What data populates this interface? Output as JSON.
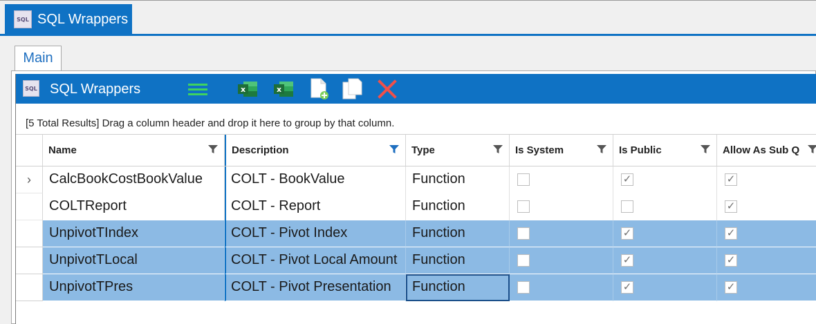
{
  "document_tab": {
    "icon": "sql-icon",
    "icon_text": "SQL",
    "title": "SQL Wrappers"
  },
  "main_tab": {
    "label": "Main"
  },
  "toolbar": {
    "icon_text": "SQL",
    "title": "SQL Wrappers",
    "buttons": [
      {
        "name": "menu-button",
        "icon": "hamburger-icon",
        "color": "#3fd35f"
      },
      {
        "name": "export-excel-button",
        "icon": "excel-icon",
        "color": "#1d8a45"
      },
      {
        "name": "export-excel-all-button",
        "icon": "excel-icon",
        "color": "#1d8a45"
      },
      {
        "name": "new-button",
        "icon": "new-document-icon"
      },
      {
        "name": "copy-button",
        "icon": "copy-icon"
      },
      {
        "name": "delete-button",
        "icon": "delete-x-icon",
        "color": "#f0504a"
      }
    ]
  },
  "group_panel": {
    "text": "[5 Total Results] Drag a column header and drop it here to group by that column."
  },
  "columns": [
    {
      "key": "name",
      "label": "Name",
      "filter_active": false
    },
    {
      "key": "description",
      "label": "Description",
      "filter_active": true
    },
    {
      "key": "type",
      "label": "Type",
      "filter_active": false
    },
    {
      "key": "is_system",
      "label": "Is System",
      "filter_active": false
    },
    {
      "key": "is_public",
      "label": "Is Public",
      "filter_active": false
    },
    {
      "key": "allow_sub",
      "label": "Allow As Sub Q",
      "filter_active": false
    }
  ],
  "rows": [
    {
      "indicator": "›",
      "name": "CalcBookCostBookValue",
      "description": "COLT - BookValue",
      "type": "Function",
      "is_system": false,
      "is_public": true,
      "allow_sub": true,
      "selected": false
    },
    {
      "indicator": "",
      "name": "COLTReport",
      "description": "COLT - Report",
      "type": "Function",
      "is_system": false,
      "is_public": false,
      "allow_sub": true,
      "selected": false
    },
    {
      "indicator": "",
      "name": "UnpivotTIndex",
      "description": "COLT - Pivot Index",
      "type": "Function",
      "is_system": false,
      "is_public": true,
      "allow_sub": true,
      "selected": true
    },
    {
      "indicator": "",
      "name": "UnpivotTLocal",
      "description": "COLT - Pivot Local Amount",
      "type": "Function",
      "is_system": false,
      "is_public": true,
      "allow_sub": true,
      "selected": true
    },
    {
      "indicator": "",
      "name": "UnpivotTPres",
      "description": "COLT - Pivot Presentation",
      "type": "Function",
      "is_system": false,
      "is_public": true,
      "allow_sub": true,
      "selected": true,
      "focused_cell": "type"
    }
  ],
  "colors": {
    "accent": "#0f72c4",
    "selection": "#8cbae4",
    "filter_active": "#1e6fc0",
    "filter_inactive": "#555555"
  }
}
